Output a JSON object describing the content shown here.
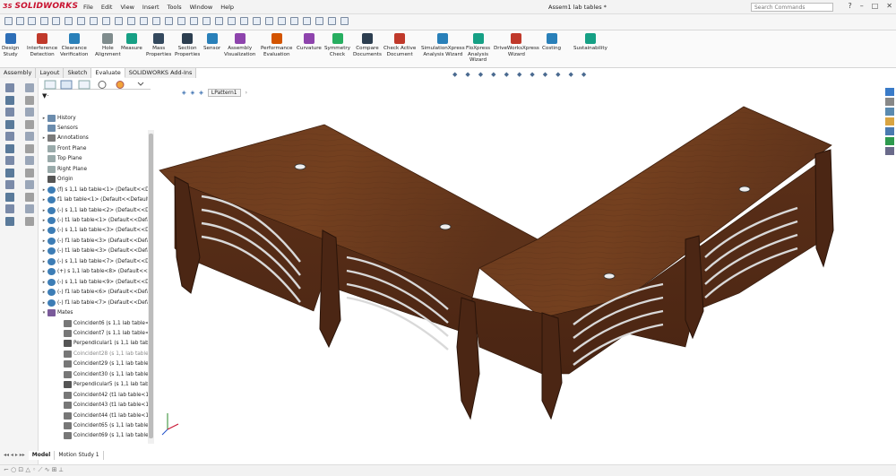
{
  "app": {
    "brand": "SOLIDWORKS",
    "document_title": "Assem1 lab tables *",
    "search_placeholder": "Search Commands"
  },
  "menu": [
    "File",
    "Edit",
    "View",
    "Insert",
    "Tools",
    "Window",
    "Help"
  ],
  "ribbon": [
    {
      "label": "Design\nStudy",
      "icon": "design-study-icon"
    },
    {
      "label": "Interference\nDetection",
      "icon": "interference-icon"
    },
    {
      "label": "Clearance\nVerification",
      "icon": "clearance-icon"
    },
    {
      "label": "Hole\nAlignment",
      "icon": "hole-alignment-icon"
    },
    {
      "label": "Measure",
      "icon": "measure-icon"
    },
    {
      "label": "Mass\nProperties",
      "icon": "mass-properties-icon"
    },
    {
      "label": "Section\nProperties",
      "icon": "section-properties-icon"
    },
    {
      "label": "Sensor",
      "icon": "sensor-icon"
    },
    {
      "label": "Assembly\nVisualization",
      "icon": "assembly-visualization-icon"
    },
    {
      "label": "Performance\nEvaluation",
      "icon": "performance-icon"
    },
    {
      "label": "Curvature",
      "icon": "curvature-icon"
    },
    {
      "label": "Symmetry\nCheck",
      "icon": "symmetry-icon"
    },
    {
      "label": "Compare\nDocuments",
      "icon": "compare-icon"
    },
    {
      "label": "Check Active\nDocument",
      "icon": "check-active-icon"
    },
    {
      "label": "SimulationXpress\nAnalysis Wizard",
      "icon": "simulationxpress-icon"
    },
    {
      "label": "FloXpress\nAnalysis\nWizard",
      "icon": "floxpress-icon"
    },
    {
      "label": "DriveWorksXpress\nWizard",
      "icon": "driveworksxpress-icon"
    },
    {
      "label": "Costing",
      "icon": "costing-icon"
    },
    {
      "label": "Sustainability",
      "icon": "sustainability-icon"
    }
  ],
  "tabs": [
    "Assembly",
    "Layout",
    "Sketch",
    "Evaluate",
    "SOLIDWORKS Add-Ins"
  ],
  "active_tab": "Evaluate",
  "breadcrumb": "LPattern1",
  "tree": [
    {
      "label": "History",
      "icon": "history-icon",
      "toggle": "▸"
    },
    {
      "label": "Sensors",
      "icon": "sensor-icon",
      "toggle": ""
    },
    {
      "label": "Annotations",
      "icon": "annotations-icon",
      "toggle": "▸"
    },
    {
      "label": "Front Plane",
      "icon": "plane-icon",
      "toggle": ""
    },
    {
      "label": "Top Plane",
      "icon": "plane-icon",
      "toggle": ""
    },
    {
      "label": "Right Plane",
      "icon": "plane-icon",
      "toggle": ""
    },
    {
      "label": "Origin",
      "icon": "origin-icon",
      "toggle": ""
    },
    {
      "label": "(f) s 1,1 lab table<1> (Default<<Def",
      "icon": "part-icon",
      "toggle": "▸"
    },
    {
      "label": "f1 lab table<1> (Default<<Default>",
      "icon": "part-icon",
      "toggle": "▸"
    },
    {
      "label": "(-) s 1,1 lab table<2> (Default<<Def",
      "icon": "part-icon",
      "toggle": "▸"
    },
    {
      "label": "(-) t1 lab table<1> (Default<<Default",
      "icon": "part-icon",
      "toggle": "▸"
    },
    {
      "label": "(-) s 1,1 lab table<3> (Default<<Def",
      "icon": "part-icon",
      "toggle": "▸"
    },
    {
      "label": "(-) f1 lab table<3> (Default<<Defaul",
      "icon": "part-icon",
      "toggle": "▸"
    },
    {
      "label": "(-) t1 lab table<3> (Default<<Defaul",
      "icon": "part-icon",
      "toggle": "▸"
    },
    {
      "label": "(-) s 1,1 lab table<7> (Default<<Def",
      "icon": "part-icon",
      "toggle": "▸"
    },
    {
      "label": "(+) s 1,1 lab table<8> (Default<<Def",
      "icon": "part-icon",
      "toggle": "▸"
    },
    {
      "label": "(-) s 1,1 lab table<9> (Default<<Def",
      "icon": "part-icon",
      "toggle": "▸"
    },
    {
      "label": "(-) f1 lab table<6> (Default<<Defaul",
      "icon": "part-icon",
      "toggle": "▸"
    },
    {
      "label": "(-) f1 lab table<7> (Default<<Defaul",
      "icon": "part-icon",
      "toggle": "▸"
    },
    {
      "label": "Mates",
      "icon": "mates-icon",
      "toggle": "▾"
    },
    {
      "label": "Coincident6 (s 1,1 lab table<1>,",
      "icon": "coincident-icon",
      "toggle": ""
    },
    {
      "label": "Coincident7 (s 1,1 lab table<1>,",
      "icon": "coincident-icon",
      "toggle": ""
    },
    {
      "label": "Perpendicular1 (s 1,1 lab table<",
      "icon": "perpendicular-icon",
      "toggle": ""
    },
    {
      "label": "Coincident28 (s 1,1 lab table<3>",
      "icon": "coincident-icon",
      "toggle": ""
    },
    {
      "label": "Coincident29 (s 1,1 lab table<3>",
      "icon": "coincident-icon",
      "toggle": ""
    },
    {
      "label": "Coincident30 (s 1,1 lab table<3>",
      "icon": "coincident-icon",
      "toggle": ""
    },
    {
      "label": "Perpendicular5 (s 1,1 lab table<",
      "icon": "perpendicular-icon",
      "toggle": ""
    },
    {
      "label": "Coincident42 (t1 lab table<1>,t",
      "icon": "coincident-icon",
      "toggle": ""
    },
    {
      "label": "Coincident43 (t1 lab table<1>,t",
      "icon": "coincident-icon",
      "toggle": ""
    },
    {
      "label": "Coincident44 (t1 lab table<1>,t",
      "icon": "coincident-icon",
      "toggle": ""
    },
    {
      "label": "Coincident65 (s 1,1 lab table<8>",
      "icon": "coincident-icon",
      "toggle": ""
    },
    {
      "label": "Coincident69 (s 1,1 lab table<8>",
      "icon": "coincident-icon",
      "toggle": ""
    }
  ],
  "bottom_tabs": [
    "Model",
    "Motion Study 1"
  ],
  "colors": {
    "wood": "#6b3a1f",
    "wood_dark": "#4e2712",
    "wood_light": "#7d4526",
    "accent": "#c8102e",
    "panel": "#f4f4f4"
  }
}
